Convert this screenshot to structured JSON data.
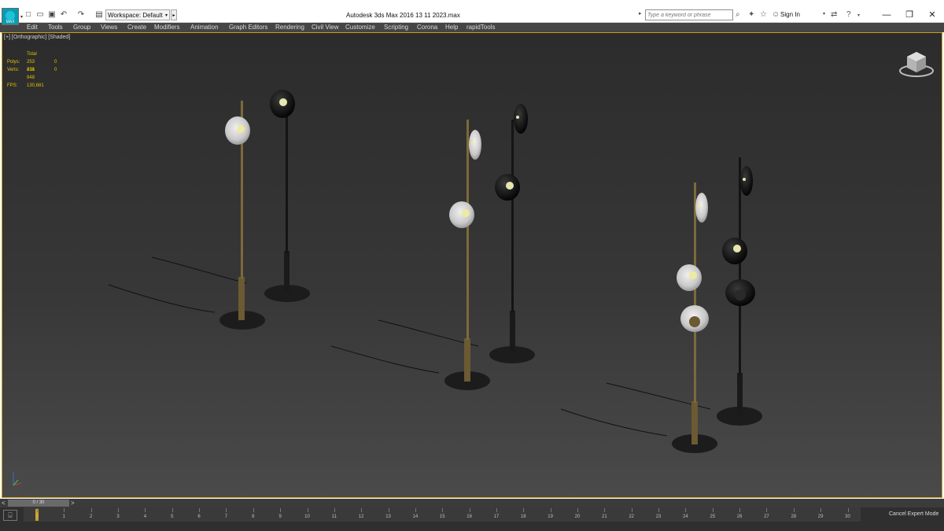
{
  "app": {
    "logo_text": "MAX",
    "title": "Autodesk 3ds Max 2016     13 11 2023.max"
  },
  "toolbar": {
    "workspace_label": "Workspace: Default",
    "icons": [
      "new-file-icon",
      "open-folder-icon",
      "save-icon",
      "undo-icon",
      "redo-icon",
      "project-folder-icon"
    ]
  },
  "search": {
    "placeholder": "Type a keyword or phrase"
  },
  "help_icons": [
    "binoculars-icon",
    "star-icon",
    "favorites-icon",
    "user-icon",
    "exchange-icon",
    "help-icon"
  ],
  "account": {
    "sign_in": "Sign In"
  },
  "menu": [
    "Edit",
    "Tools",
    "Group",
    "Views",
    "Create",
    "Modifiers",
    "Animation",
    "Graph Editors",
    "Rendering",
    "Civil View",
    "Customize",
    "Scripting",
    "Corona",
    "Help",
    "rapidTools"
  ],
  "viewport": {
    "label": "[+] [Orthographic] [Shaded]",
    "stats": {
      "header": "Total",
      "polys_label": "Polys:",
      "polys_value": "253 416",
      "polys_selected": "0",
      "verts_label": "Verts:",
      "verts_value": "231 948",
      "verts_selected": "0",
      "fps_label": "FPS:",
      "fps_value": "130,681"
    }
  },
  "timeline": {
    "frame_display": "0 / 30",
    "prev": "<",
    "next": ">",
    "ticks": [
      "0",
      "1",
      "2",
      "3",
      "4",
      "5",
      "6",
      "7",
      "8",
      "9",
      "10",
      "11",
      "12",
      "13",
      "14",
      "15",
      "16",
      "17",
      "18",
      "19",
      "20",
      "21",
      "22",
      "23",
      "24",
      "25",
      "26",
      "27",
      "28",
      "29",
      "30"
    ],
    "cancel_expert": "Cancel Expert Mode"
  },
  "colors": {
    "accent_gold": "#c8a020",
    "stats_yellow": "#e0c200",
    "menu_bg": "#454545"
  }
}
